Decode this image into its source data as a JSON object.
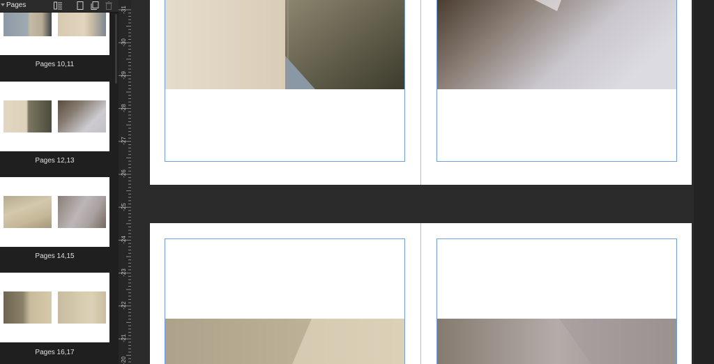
{
  "panel": {
    "title": "Pages",
    "icons": [
      "page-list-icon",
      "single-page-icon",
      "duplicate-page-icon",
      "delete-icon"
    ],
    "spreads": [
      {
        "label": "Pages 10,11"
      },
      {
        "label": "Pages 12,13"
      },
      {
        "label": "Pages 14,15"
      },
      {
        "label": "Pages 16,17"
      }
    ]
  },
  "ruler": {
    "labels": [
      "-31",
      "-30",
      "-29",
      "-28",
      "-27",
      "-26",
      "-25",
      "-24",
      "-23",
      "-22",
      "-21",
      "-20"
    ]
  },
  "colors": {
    "canvas_bg": "#2b2b2b",
    "margin_guide": "#6d9ee0",
    "panel_bg": "#1f1f1f"
  }
}
